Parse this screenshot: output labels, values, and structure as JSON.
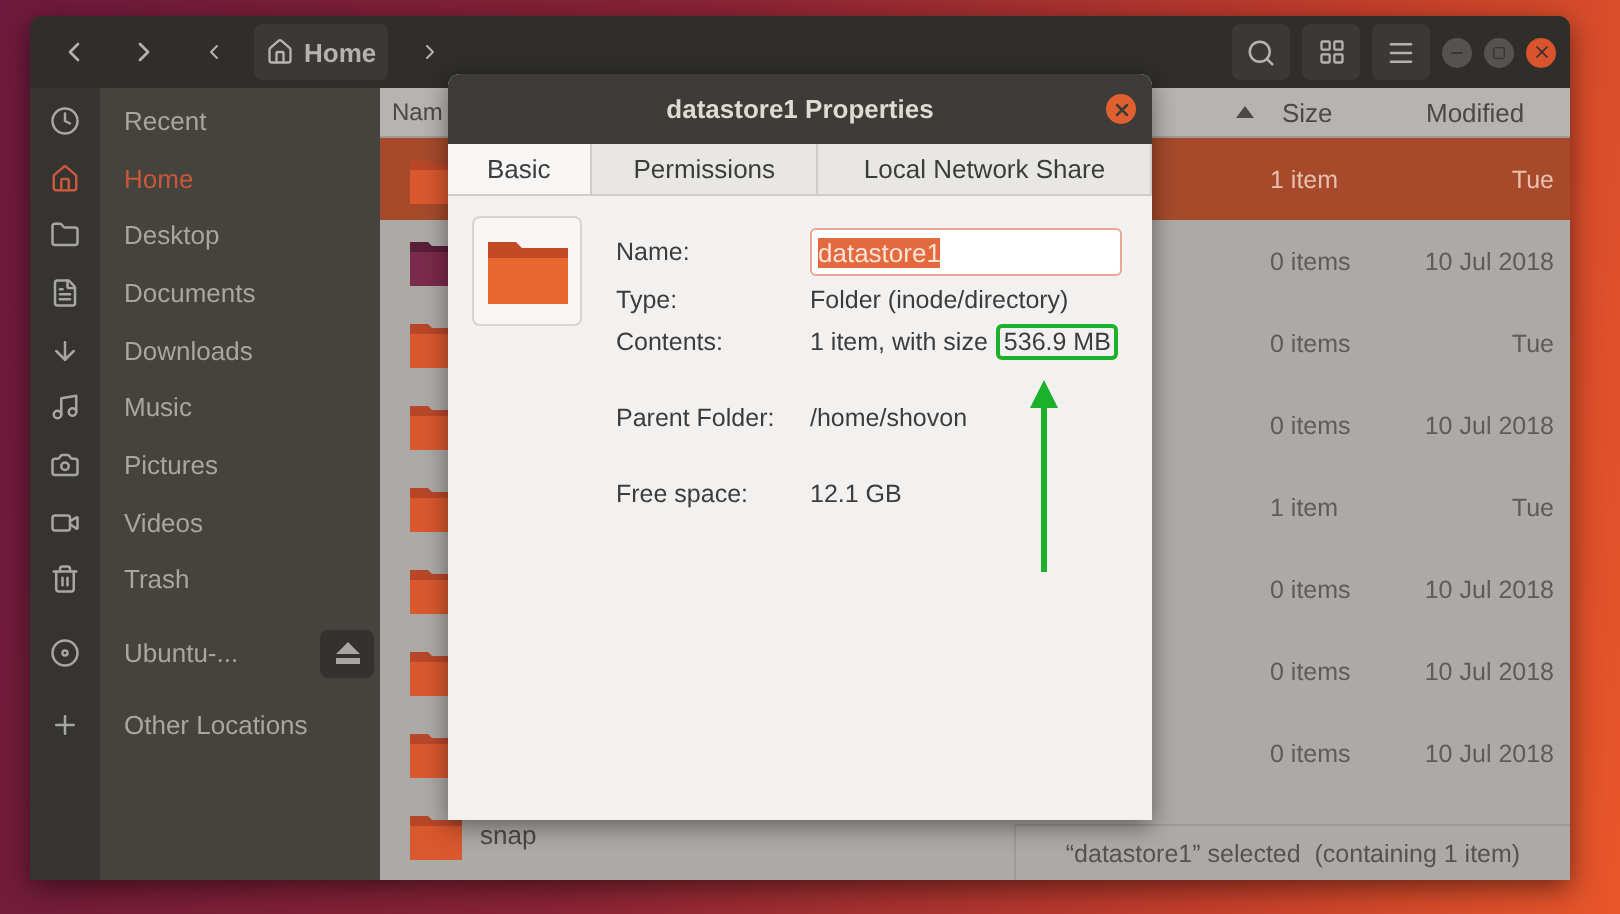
{
  "window": {
    "location": "Home"
  },
  "sidebar": {
    "items": [
      {
        "label": "Recent",
        "selected": false,
        "ejectable": false
      },
      {
        "label": "Home",
        "selected": true,
        "ejectable": false
      },
      {
        "label": "Desktop",
        "selected": false,
        "ejectable": false
      },
      {
        "label": "Documents",
        "selected": false,
        "ejectable": false
      },
      {
        "label": "Downloads",
        "selected": false,
        "ejectable": false
      },
      {
        "label": "Music",
        "selected": false,
        "ejectable": false
      },
      {
        "label": "Pictures",
        "selected": false,
        "ejectable": false
      },
      {
        "label": "Videos",
        "selected": false,
        "ejectable": false
      },
      {
        "label": "Trash",
        "selected": false,
        "ejectable": false
      },
      {
        "label": "Ubuntu-...",
        "selected": false,
        "ejectable": true
      },
      {
        "label": "Other Locations",
        "selected": false,
        "ejectable": false
      }
    ]
  },
  "file_list": {
    "columns": [
      "Nam",
      "Size",
      "Modified"
    ],
    "rows": [
      {
        "kind": "folder",
        "size": "1 item",
        "modified": "Tue",
        "selected": true
      },
      {
        "kind": "desktop",
        "size": "0 items",
        "modified": "10 Jul 2018",
        "selected": false
      },
      {
        "kind": "folder",
        "size": "0 items",
        "modified": "Tue",
        "selected": false
      },
      {
        "kind": "folder",
        "size": "0 items",
        "modified": "10 Jul 2018",
        "selected": false
      },
      {
        "kind": "folder",
        "size": "1 item",
        "modified": "Tue",
        "selected": false
      },
      {
        "kind": "folder",
        "size": "0 items",
        "modified": "10 Jul 2018",
        "selected": false
      },
      {
        "kind": "folder",
        "size": "0 items",
        "modified": "10 Jul 2018",
        "selected": false
      },
      {
        "kind": "folder",
        "size": "0 items",
        "modified": "10 Jul 2018",
        "selected": false
      },
      {
        "kind": "folder",
        "name": "snap",
        "selected": false
      }
    ]
  },
  "status_bar": {
    "text": "“datastore1” selected  (containing 1 item)"
  },
  "dialog": {
    "title": "datastore1 Properties",
    "tabs": [
      {
        "label": "Basic",
        "selected": true
      },
      {
        "label": "Permissions",
        "selected": false
      },
      {
        "label": "Local Network Share",
        "selected": false
      }
    ],
    "groups": [
      {
        "rows": [
          {
            "kind": "input",
            "label": "Name:",
            "value": "datastore1"
          },
          {
            "kind": "text",
            "label": "Type:",
            "value": "Folder (inode/directory)"
          },
          {
            "kind": "text",
            "label": "Contents:",
            "value": "1 item, with size",
            "highlighted": "536.9 MB"
          }
        ]
      },
      {
        "rows": [
          {
            "kind": "text",
            "label": "Parent Folder:",
            "value": "/home/shovon"
          }
        ]
      },
      {
        "rows": [
          {
            "kind": "text",
            "label": "Free space:",
            "value": "12.1 GB"
          }
        ]
      }
    ]
  }
}
